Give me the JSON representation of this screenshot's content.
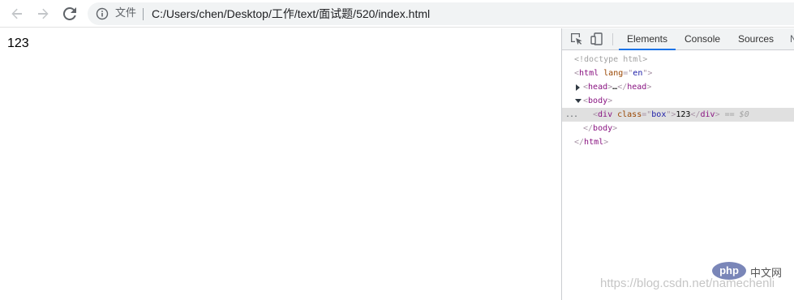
{
  "browser": {
    "scheme_label": "文件",
    "url": "C:/Users/chen/Desktop/工作/text/面试题/520/index.html",
    "icons": [
      "back-arrow-icon",
      "forward-arrow-icon",
      "reload-icon",
      "info-icon"
    ]
  },
  "page": {
    "box_text": "123"
  },
  "devtools": {
    "tabs": [
      {
        "label": "Elements",
        "active": true
      },
      {
        "label": "Console",
        "active": false
      },
      {
        "label": "Sources",
        "active": false
      },
      {
        "label": "N",
        "active": false
      }
    ],
    "icons": [
      "inspect-element-icon",
      "device-toolbar-icon"
    ],
    "dom": {
      "doctype": "<!doctype html>",
      "html_tag": "html",
      "html_attr": "lang",
      "html_val": "en",
      "head_tag": "head",
      "head_collapsed": "…",
      "body_tag": "body",
      "div_tag": "div",
      "div_attr": "class",
      "div_val": "box",
      "div_text": "123",
      "selected_marker": "== $0",
      "ellipsis": "..."
    }
  },
  "watermark": {
    "text": "https://blog.csdn.net/namechenli",
    "logo": "php",
    "logo_suffix": "中文网"
  },
  "colors": {
    "accent": "#1a73e8",
    "tag": "#881280",
    "attr": "#994500",
    "value": "#1a1aa6"
  }
}
